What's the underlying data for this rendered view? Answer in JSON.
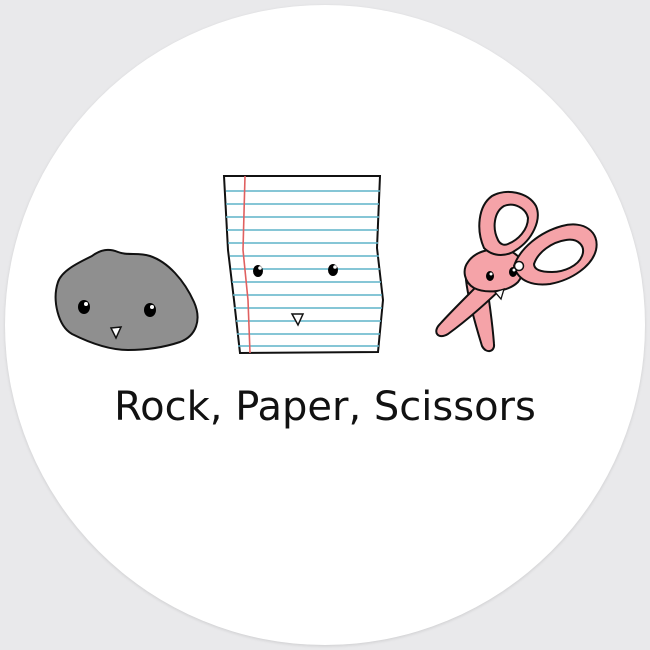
{
  "caption": "Rock, Paper, Scissors",
  "colors": {
    "background": "#e9e9eb",
    "sticker": "#ffffff",
    "rock": "#8f8f8f",
    "paper_rule": "#5fb3c9",
    "paper_margin": "#e06060",
    "scissors": "#f5a3a8"
  },
  "characters": [
    {
      "name": "rock",
      "icon": "rock-face-icon"
    },
    {
      "name": "paper",
      "icon": "paper-face-icon"
    },
    {
      "name": "scissors",
      "icon": "scissors-face-icon"
    }
  ]
}
